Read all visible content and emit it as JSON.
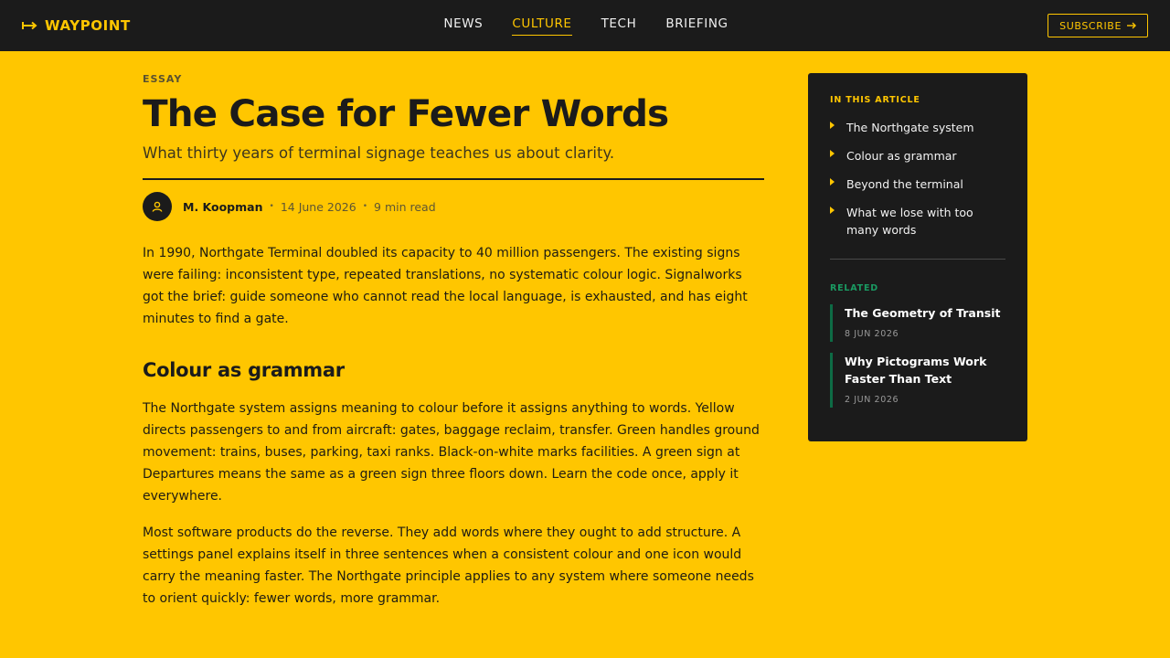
{
  "header": {
    "brand": "WAYPOINT",
    "brand_icon": "arrow-bar-icon",
    "nav": [
      {
        "label": "NEWS",
        "active": false
      },
      {
        "label": "CULTURE",
        "active": true
      },
      {
        "label": "TECH",
        "active": false
      },
      {
        "label": "BRIEFING",
        "active": false
      }
    ],
    "subscribe_label": "SUBSCRIBE",
    "subscribe_icon": "arrow-right-icon"
  },
  "article": {
    "kicker": "ESSAY",
    "title": "The Case for Fewer Words",
    "dek": "What thirty years of terminal signage teaches us about clarity.",
    "author": "M. Koopman",
    "date": "14 June 2026",
    "read_time": "9 min read",
    "paragraph_1": "In 1990, Northgate Terminal doubled its capacity to 40 million passengers. The existing signs were failing: inconsistent type, repeated translations, no systematic colour logic. Signalworks got the brief: guide someone who cannot read the local language, is exhausted, and has eight minutes to find a gate.",
    "heading_1": "Colour as grammar",
    "paragraph_2": "The Northgate system assigns meaning to colour before it assigns anything to words. Yellow directs passengers to and from aircraft: gates, baggage reclaim, transfer. Green handles ground movement: trains, buses, parking, taxi ranks. Black-on-white marks facilities. A green sign at Departures means the same as a green sign three floors down. Learn the code once, apply it everywhere.",
    "paragraph_3": "Most software products do the reverse. They add words where they ought to add structure. A settings panel explains itself in three sentences when a consistent colour and one icon would carry the meaning faster. The Northgate principle applies to any system where someone needs to orient quickly: fewer words, more grammar."
  },
  "sidebar": {
    "toc_label": "IN THIS ARTICLE",
    "toc": [
      "The Northgate system",
      "Colour as grammar",
      "Beyond the terminal",
      "What we lose with too many words"
    ],
    "related_label": "RELATED",
    "related": [
      {
        "title": "The Geometry of Transit",
        "date": "8 JUN 2026"
      },
      {
        "title": "Why Pictograms Work Faster Than Text",
        "date": "2 JUN 2026"
      }
    ]
  },
  "colors": {
    "background": "#FFC600",
    "ink": "#1B1B1B",
    "accent_green": "#0D6B45"
  }
}
